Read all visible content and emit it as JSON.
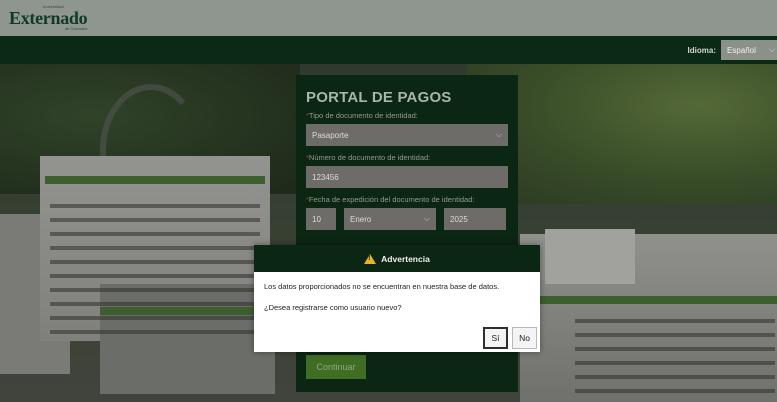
{
  "header": {
    "logo": {
      "small": "Universidad",
      "main": "Externado",
      "sub": "de Colombia"
    },
    "language_label": "Idioma:",
    "language_value": "Español"
  },
  "portal": {
    "title": "PORTAL DE PAGOS",
    "required_mark": "*",
    "doc_type_label": "Tipo de documento de identidad:",
    "doc_type_value": "Pasaporte",
    "doc_number_label": "Número de documento de identidad:",
    "doc_number_value": "123456",
    "issue_date_label": "Fecha de expedición del documento de identidad:",
    "issue_day": "10",
    "issue_month": "Enero",
    "issue_year": "2025",
    "continue_label": "Continuar"
  },
  "modal": {
    "title": "Advertencia",
    "message": "Los datos proporcionados no se encuentran en nuestra base de datos.",
    "question": "¿Desea registrarse como usuario nuevo?",
    "yes_label": "Sí",
    "no_label": "No"
  },
  "colors": {
    "dark_green": "#0b2612",
    "button_green": "#3f6d24",
    "warning": "#e8b423"
  }
}
